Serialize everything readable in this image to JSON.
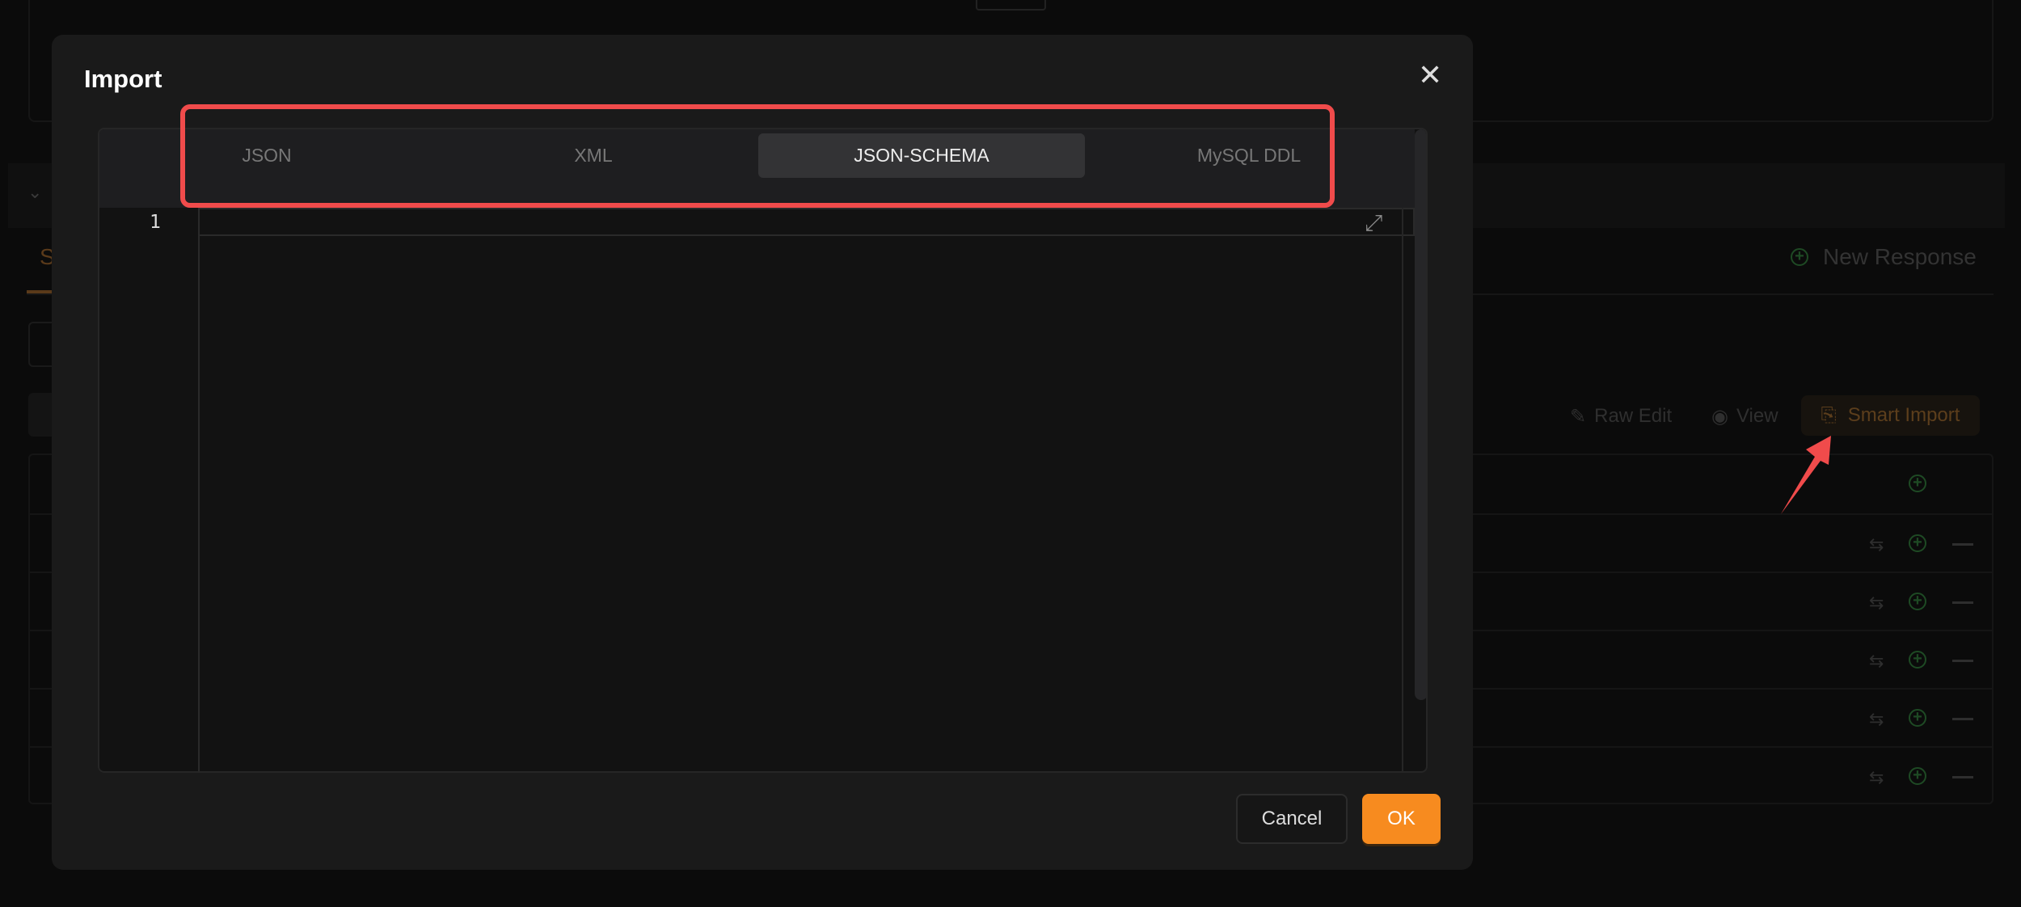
{
  "background": {
    "tab_partial": "S",
    "new_response": "New Response",
    "toolbar": {
      "raw_edit": "Raw Edit",
      "view": "View",
      "smart_import": "Smart Import"
    },
    "row_count": 6
  },
  "modal": {
    "title": "Import",
    "tabs": [
      {
        "label": "JSON",
        "active": false
      },
      {
        "label": "XML",
        "active": false
      },
      {
        "label": "JSON-SCHEMA",
        "active": true
      },
      {
        "label": "MySQL DDL",
        "active": false
      }
    ],
    "editor": {
      "line_numbers": [
        "1"
      ],
      "content": ""
    },
    "cancel_label": "Cancel",
    "ok_label": "OK"
  },
  "colors": {
    "accent": "#f78b1f",
    "annotation": "#f04b4b",
    "add_icon": "#1e4a24"
  }
}
